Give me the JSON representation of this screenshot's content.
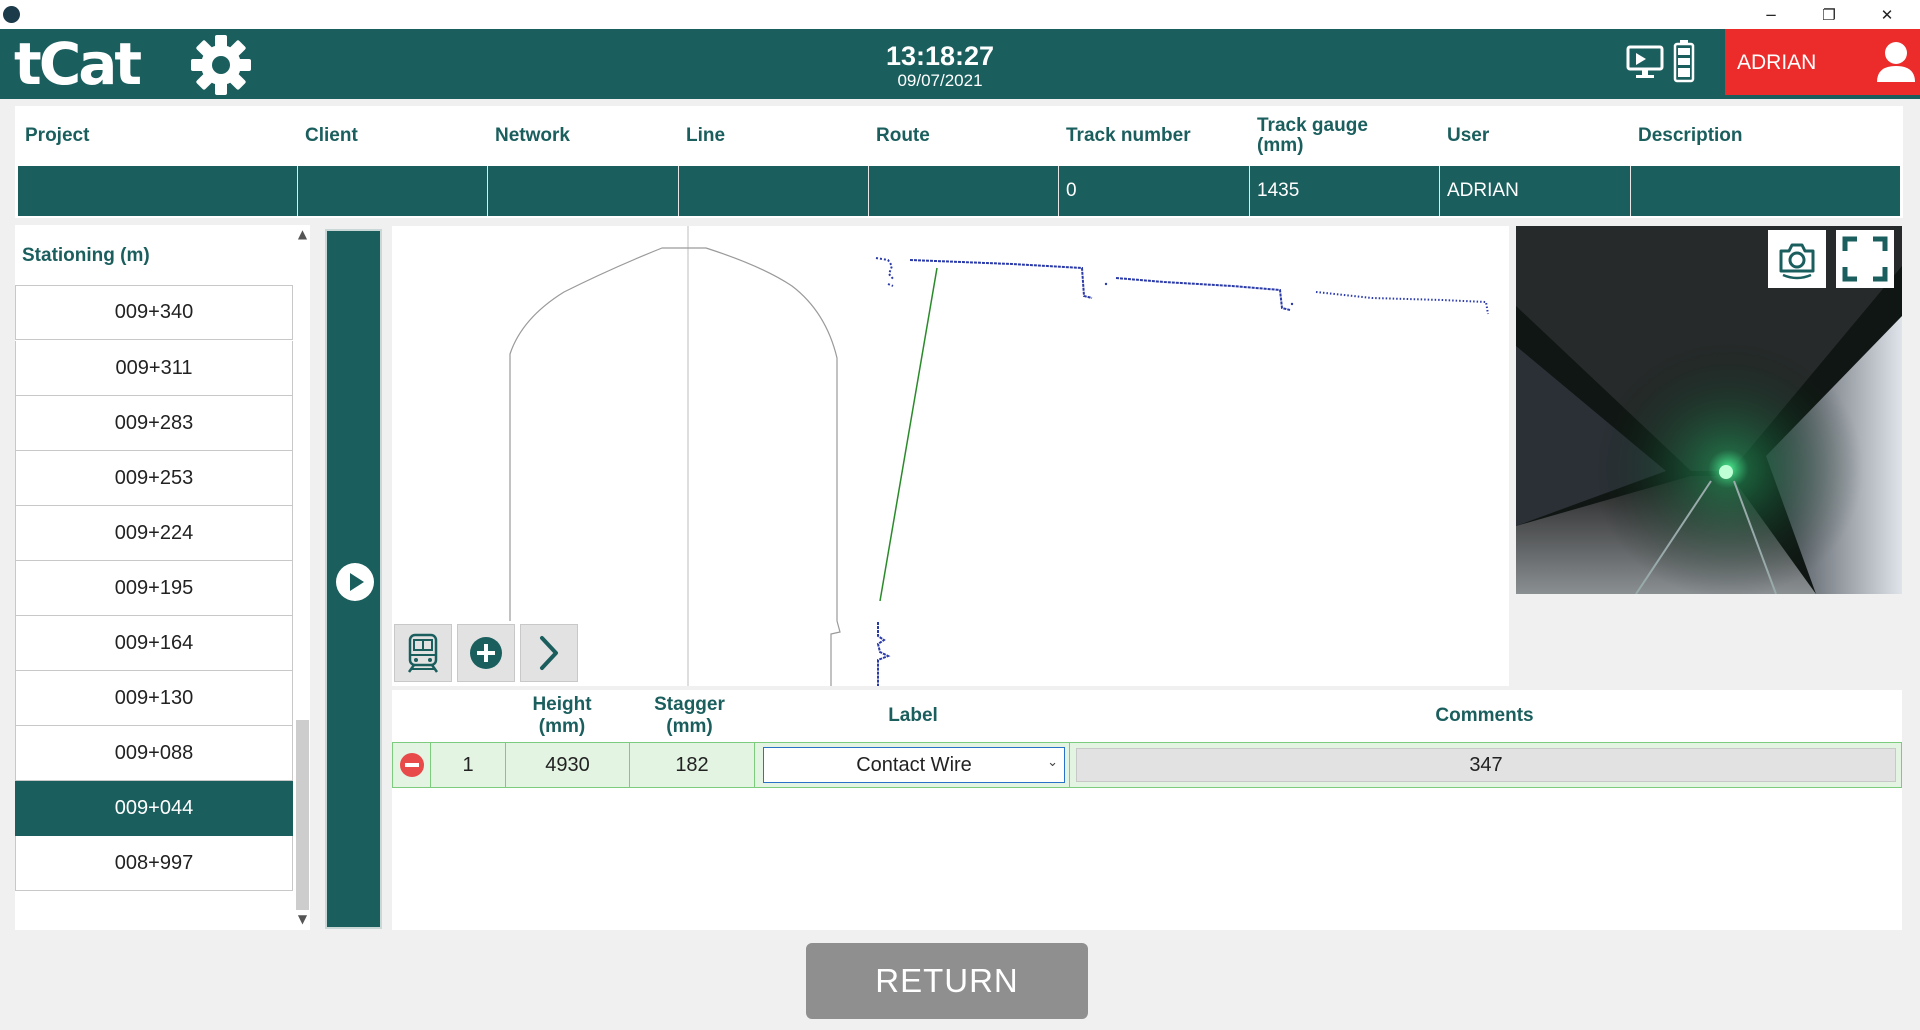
{
  "window": {
    "controls": {
      "minimize": "−",
      "restore": "❐",
      "close": "✕"
    }
  },
  "header": {
    "logo": "tCat",
    "time": "13:18:27",
    "date": "09/07/2021",
    "user": "ADRIAN",
    "colors": {
      "brand": "#1b5e5e",
      "user_accent": "#ec2b2b"
    }
  },
  "info": {
    "headers": [
      "Project",
      "Client",
      "Network",
      "Line",
      "Route",
      "Track number",
      "Track gauge (mm)",
      "User",
      "Description"
    ],
    "values": [
      "",
      "",
      "",
      "",
      "",
      "0",
      "1435",
      "ADRIAN",
      ""
    ]
  },
  "stationing": {
    "header": "Stationing (m)",
    "items": [
      "009+340",
      "009+311",
      "009+283",
      "009+253",
      "009+224",
      "009+195",
      "009+164",
      "009+130",
      "009+088",
      "009+044",
      "008+997"
    ],
    "selected": "009+044"
  },
  "toolbar": {
    "icons": [
      "train-icon",
      "add-circle-icon",
      "chevron-right-icon"
    ]
  },
  "camera": {
    "icons": [
      "camera-capture-icon",
      "fullscreen-icon"
    ]
  },
  "measurements": {
    "headers": {
      "height": "Height\n(mm)",
      "stagger": "Stagger\n(mm)",
      "label": "Label",
      "comments": "Comments"
    },
    "rows": [
      {
        "index": "1",
        "height": "4930",
        "stagger": "182",
        "label": "Contact Wire",
        "comment": "347"
      }
    ]
  },
  "return_label": "RETURN"
}
